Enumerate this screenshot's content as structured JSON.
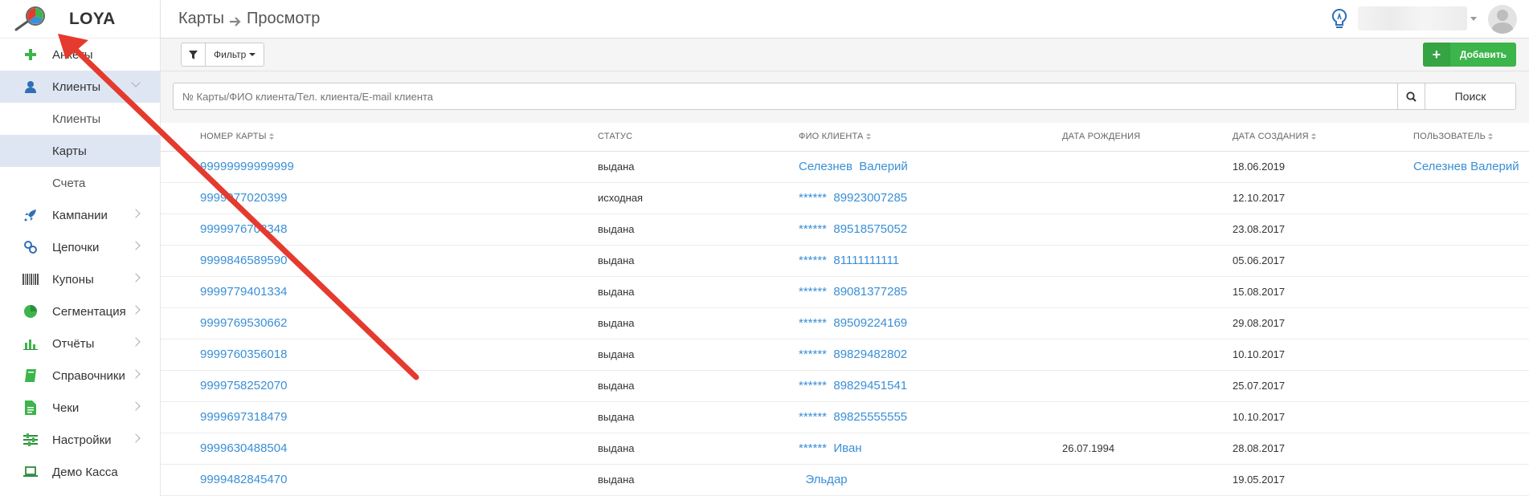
{
  "app": {
    "name": "LOYA"
  },
  "breadcrumb": {
    "parent": "Карты",
    "current": "Просмотр"
  },
  "sidebar": {
    "items": [
      {
        "label": "Анкеты",
        "icon": "plus-icon"
      },
      {
        "label": "Клиенты",
        "icon": "user-icon",
        "active": true,
        "expanded": true,
        "children": [
          {
            "label": "Клиенты"
          },
          {
            "label": "Карты",
            "active": true
          },
          {
            "label": "Счета"
          }
        ]
      },
      {
        "label": "Кампании",
        "icon": "rocket-icon"
      },
      {
        "label": "Цепочки",
        "icon": "link-icon"
      },
      {
        "label": "Купоны",
        "icon": "barcode-icon"
      },
      {
        "label": "Сегментация",
        "icon": "pie-chart-icon"
      },
      {
        "label": "Отчёты",
        "icon": "bar-chart-icon"
      },
      {
        "label": "Справочники",
        "icon": "book-icon"
      },
      {
        "label": "Чеки",
        "icon": "document-icon"
      },
      {
        "label": "Настройки",
        "icon": "sliders-icon"
      },
      {
        "label": "Демо Касса",
        "icon": "laptop-icon"
      }
    ]
  },
  "toolbar": {
    "filter_label": "Фильтр",
    "add_label": "Добавить"
  },
  "search": {
    "placeholder": "№ Карты/ФИО клиента/Тел. клиента/E-mail клиента",
    "button_label": "Поиск"
  },
  "table": {
    "columns": [
      "Номер карты",
      "Статус",
      "ФИО клиента",
      "Дата рождения",
      "Дата создания",
      "Пользователь"
    ],
    "rows": [
      {
        "card": "99999999999999",
        "status": "выдана",
        "client": "Селезнев  Валерий",
        "birth": "",
        "created": "18.06.2019",
        "user": "Селезнев Валерий"
      },
      {
        "card": "9999977020399",
        "status": "исходная",
        "client": "******  89923007285",
        "birth": "",
        "created": "12.10.2017",
        "user": ""
      },
      {
        "card": "9999976708348",
        "status": "выдана",
        "client": "******  89518575052",
        "birth": "",
        "created": "23.08.2017",
        "user": ""
      },
      {
        "card": "9999846589590",
        "status": "выдана",
        "client": "******  81111111111",
        "birth": "",
        "created": "05.06.2017",
        "user": ""
      },
      {
        "card": "9999779401334",
        "status": "выдана",
        "client": "******  89081377285",
        "birth": "",
        "created": "15.08.2017",
        "user": ""
      },
      {
        "card": "9999769530662",
        "status": "выдана",
        "client": "******  89509224169",
        "birth": "",
        "created": "29.08.2017",
        "user": ""
      },
      {
        "card": "9999760356018",
        "status": "выдана",
        "client": "******  89829482802",
        "birth": "",
        "created": "10.10.2017",
        "user": ""
      },
      {
        "card": "9999758252070",
        "status": "выдана",
        "client": "******  89829451541",
        "birth": "",
        "created": "25.07.2017",
        "user": ""
      },
      {
        "card": "9999697318479",
        "status": "выдана",
        "client": "******  89825555555",
        "birth": "",
        "created": "10.10.2017",
        "user": ""
      },
      {
        "card": "9999630488504",
        "status": "выдана",
        "client": "******  Иван",
        "birth": "26.07.1994",
        "created": "28.08.2017",
        "user": ""
      },
      {
        "card": "9999482845470",
        "status": "выдана",
        "client": "  Эльдар",
        "birth": "",
        "created": "19.05.2017",
        "user": ""
      }
    ]
  },
  "colors": {
    "accent": "#3a8fd6",
    "active_bg": "#dfe6f3",
    "add_green": "#3cb54a",
    "annotation_red": "#e53a2e"
  }
}
